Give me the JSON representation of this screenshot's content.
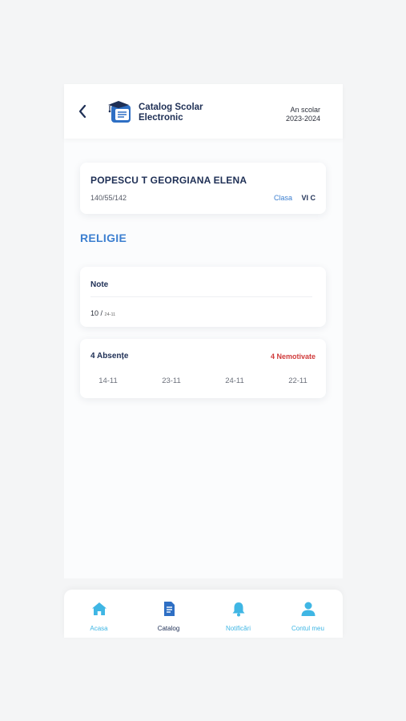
{
  "header": {
    "back_icon": "chevron-left-icon",
    "logo_icon": "catalog-logo-icon",
    "app_title_line1": "Catalog Scolar",
    "app_title_line2": "Electronic",
    "year_label": "An scolar",
    "year_value": "2023-2024"
  },
  "student": {
    "name": "POPESCU T GEORGIANA ELENA",
    "id": "140/55/142",
    "class_label": "Clasa",
    "class_value": "VI C"
  },
  "subject": {
    "title": "RELIGIE"
  },
  "notes": {
    "title": "Note",
    "grade": "10 / ",
    "grade_date": "24-11"
  },
  "absences": {
    "title": "4 Absențe",
    "unmotivated": "4 Nemotivate",
    "dates": [
      "14-11",
      "23-11",
      "24-11",
      "22-11"
    ]
  },
  "nav": {
    "items": [
      {
        "label": "Acasa",
        "icon": "home-icon"
      },
      {
        "label": "Catalog",
        "icon": "document-icon"
      },
      {
        "label": "Notificări",
        "icon": "bell-icon"
      },
      {
        "label": "Contul meu",
        "icon": "user-icon"
      }
    ],
    "active_index": 1
  },
  "colors": {
    "navy": "#1e2f55",
    "accent_blue": "#3c7fd0",
    "nav_cyan": "#3fb6e4",
    "alert_red": "#d03a3a"
  }
}
